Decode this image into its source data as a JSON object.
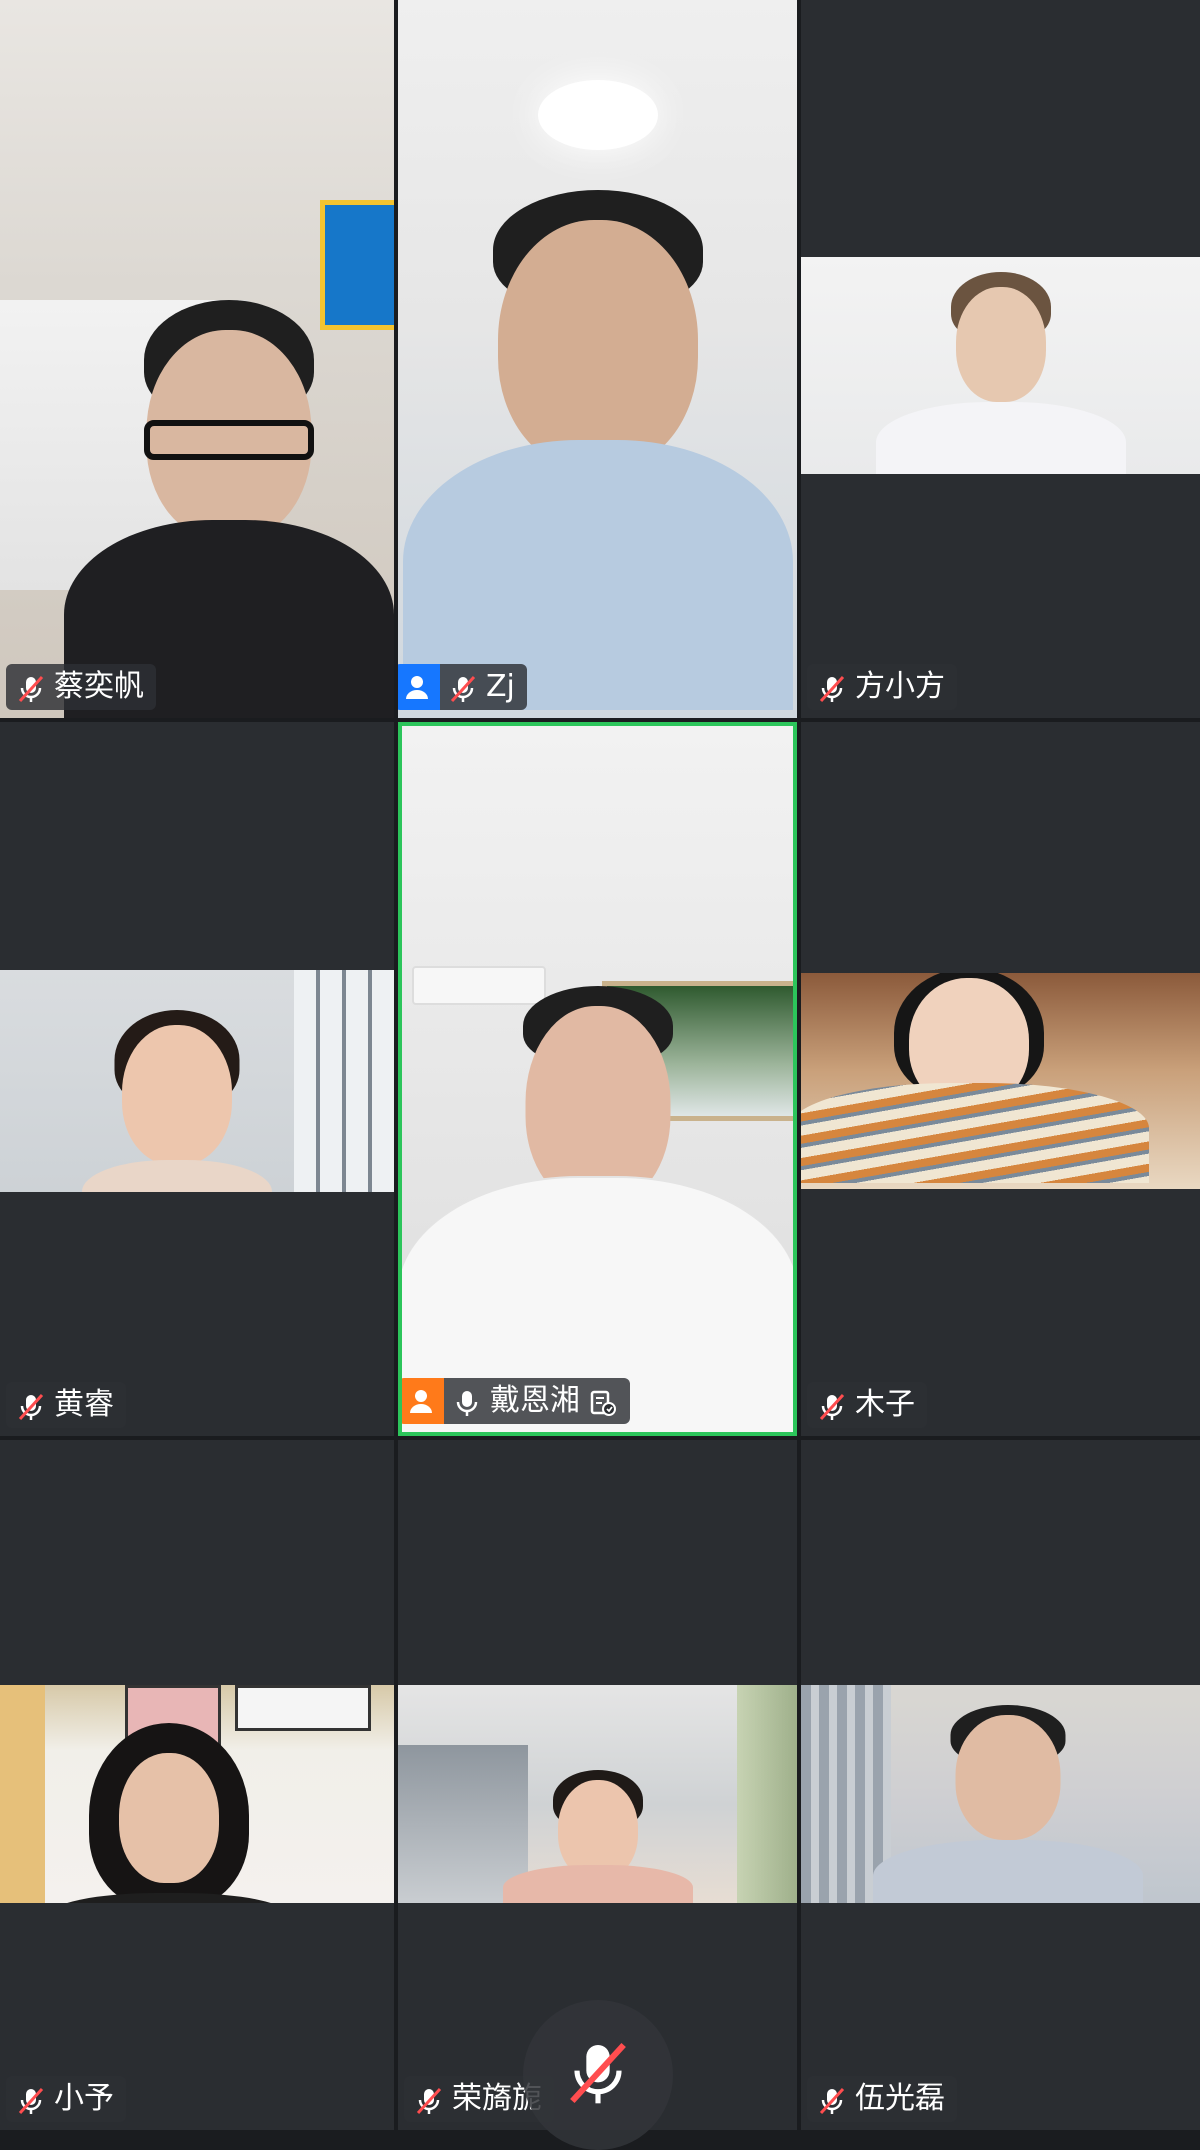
{
  "participants": [
    {
      "name": "蔡奕帆",
      "muted": true,
      "role": ""
    },
    {
      "name": "Zj",
      "muted": true,
      "role": "host"
    },
    {
      "name": "方小方",
      "muted": true,
      "role": ""
    },
    {
      "name": "黄睿",
      "muted": true,
      "role": ""
    },
    {
      "name": "戴恩湘",
      "muted": false,
      "role": "co-host",
      "speaking": true,
      "extra_icon": "share-screen-icon"
    },
    {
      "name": "木子",
      "muted": true,
      "role": ""
    },
    {
      "name": "小予",
      "muted": true,
      "role": ""
    },
    {
      "name": "荣旖旎",
      "muted": true,
      "role": ""
    },
    {
      "name": "伍光磊",
      "muted": true,
      "role": ""
    }
  ],
  "colors": {
    "background": "#1a1c1f",
    "tile": "#2a2d31",
    "active_border": "#2cc55b",
    "host_badge": "#1677ff",
    "cohost_badge": "#ff7a1a",
    "mute_slash": "#ff4d4f"
  },
  "controls": {
    "bottom_mic_icon": "mic-muted-icon"
  }
}
